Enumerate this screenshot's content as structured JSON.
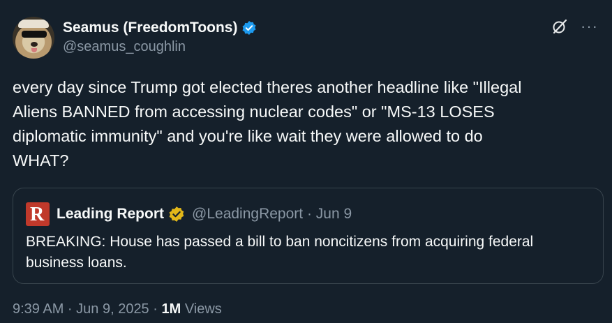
{
  "author": {
    "display_name": "Seamus (FreedomToons)",
    "handle": "@seamus_coughlin",
    "verified_color": "#1d9bf0"
  },
  "actions": {
    "grok_icon": "grok-icon",
    "more_label": "···"
  },
  "tweet": {
    "text": "every day since Trump got elected theres another headline like \"Illegal\nAliens BANNED from accessing nuclear codes\" or \"MS-13 LOSES\ndiplomatic immunity\" and you're like wait they were allowed to do\nWHAT?"
  },
  "quote": {
    "display_name": "Leading Report",
    "handle_and_date": "@LeadingReport · Jun 9",
    "verified_color": "#e2b719",
    "logo_letter": "R",
    "text": "BREAKING: House has passed a bill to ban noncitizens from acquiring federal business loans."
  },
  "meta": {
    "time_date": "9:39 AM · Jun 9, 2025 · ",
    "views_count": "1M",
    "views_label": " Views"
  }
}
